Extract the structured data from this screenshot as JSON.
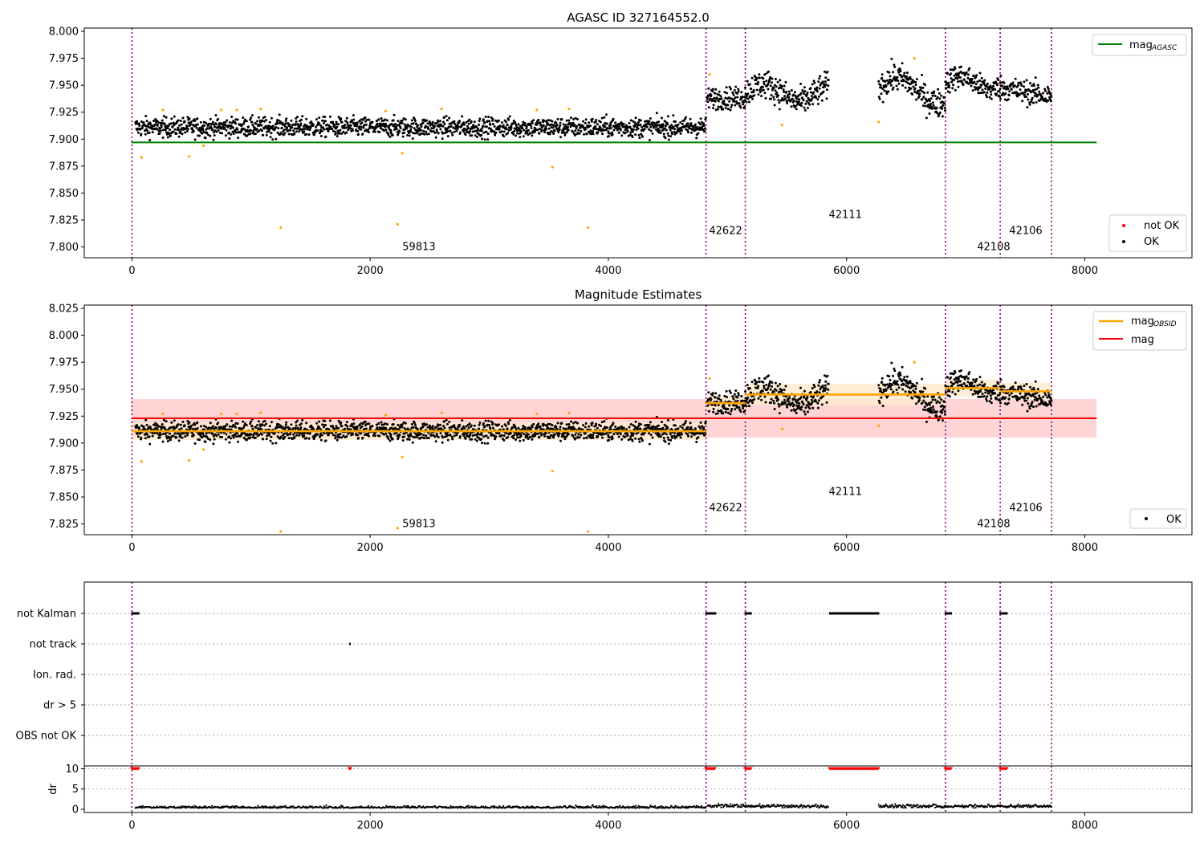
{
  "chart_data": [
    {
      "type": "scatter",
      "title": "AGASC ID 327164552.0",
      "xlim": [
        -400,
        8900
      ],
      "ylim": [
        7.79,
        8.003
      ],
      "x_ticks": [
        "0",
        "2000",
        "4000",
        "6000",
        "8000"
      ],
      "y_ticks": [
        "7.800",
        "7.825",
        "7.850",
        "7.875",
        "7.900",
        "7.925",
        "7.950",
        "7.975",
        "8.000"
      ],
      "legend_upper": {
        "position": "upper right",
        "entries": [
          {
            "label": "mag",
            "sub": "AGASC",
            "color": "#008000"
          }
        ]
      },
      "legend_lower": {
        "position": "lower right",
        "entries": [
          {
            "label": "not OK",
            "color": "#ff0000"
          },
          {
            "label": "OK",
            "color": "#000000"
          }
        ]
      },
      "mag_agasc": 7.897,
      "obsid_boundaries": [
        0,
        4820,
        5150,
        6830,
        7290,
        7720
      ],
      "obsid_labels": [
        {
          "text": "59813",
          "x": 2410,
          "y": 7.797
        },
        {
          "text": "42622",
          "x": 4985,
          "y": 7.812
        },
        {
          "text": "42111",
          "x": 5990,
          "y": 7.827
        },
        {
          "text": "42108",
          "x": 7235,
          "y": 7.797
        },
        {
          "text": "42106",
          "x": 7505,
          "y": 7.812
        }
      ]
    },
    {
      "type": "scatter",
      "title": "Magnitude Estimates",
      "xlim": [
        -400,
        8900
      ],
      "ylim": [
        7.815,
        8.028
      ],
      "x_ticks": [
        "0",
        "2000",
        "4000",
        "6000",
        "8000"
      ],
      "y_ticks": [
        "7.825",
        "7.850",
        "7.875",
        "7.900",
        "7.925",
        "7.950",
        "7.975",
        "8.000",
        "8.025"
      ],
      "legend_upper": {
        "position": "upper right",
        "entries": [
          {
            "label": "mag",
            "sub": "OBSID",
            "color": "#ffa500"
          },
          {
            "label": "mag",
            "color": "#ff0000"
          }
        ]
      },
      "legend_lower": {
        "position": "lower right",
        "entries": [
          {
            "label": "OK",
            "color": "#000000"
          }
        ]
      },
      "mag": 7.923,
      "mag_band": [
        7.905,
        7.941
      ],
      "mag_obsid": [
        {
          "start": 0,
          "end": 4820,
          "value": 7.911,
          "band": [
            7.903,
            7.919
          ]
        },
        {
          "start": 4820,
          "end": 5150,
          "value": 7.937,
          "band": [
            7.93,
            7.944
          ]
        },
        {
          "start": 5150,
          "end": 6830,
          "value": 7.945,
          "band": [
            7.935,
            7.955
          ]
        },
        {
          "start": 6830,
          "end": 7290,
          "value": 7.951,
          "band": [
            7.943,
            7.959
          ]
        },
        {
          "start": 7290,
          "end": 7720,
          "value": 7.948,
          "band": [
            7.94,
            7.956
          ]
        }
      ],
      "obsid_labels": [
        {
          "text": "59813",
          "x": 2410,
          "y": 7.822
        },
        {
          "text": "42622",
          "x": 4985,
          "y": 7.837
        },
        {
          "text": "42111",
          "x": 5990,
          "y": 7.852
        },
        {
          "text": "42108",
          "x": 7235,
          "y": 7.822
        },
        {
          "text": "42106",
          "x": 7505,
          "y": 7.837
        }
      ]
    },
    {
      "type": "scatter",
      "title": "",
      "xlim": [
        -400,
        8900
      ],
      "categories": [
        "not Kalman",
        "not track",
        "Ion. rad.",
        "dr > 5",
        "OBS not OK"
      ],
      "flag_ranges": {
        "not Kalman": [
          [
            0,
            60
          ],
          [
            4820,
            4900
          ],
          [
            5150,
            5200
          ],
          [
            5860,
            6270
          ],
          [
            6830,
            6880
          ],
          [
            7290,
            7350
          ]
        ],
        "not track": [
          [
            1830,
            1835
          ]
        ],
        "Ion. rad.": [],
        "dr > 5": [],
        "OBS not OK": []
      }
    },
    {
      "type": "scatter",
      "title": "",
      "xlim": [
        -400,
        8900
      ],
      "ylim": [
        -0.8,
        10.7
      ],
      "ylabel": "dr",
      "y_ticks": [
        "0",
        "5",
        "10"
      ],
      "x_ticks": [
        "0",
        "2000",
        "4000",
        "6000",
        "8000"
      ],
      "dr_clipped_ranges": [
        [
          0,
          60
        ],
        [
          1825,
          1835
        ],
        [
          4820,
          4900
        ],
        [
          5150,
          5200
        ],
        [
          5860,
          6270
        ],
        [
          6830,
          6880
        ],
        [
          7290,
          7350
        ]
      ],
      "dr_typical": 0.3
    }
  ],
  "colors": {
    "ok": "#000000",
    "not_ok": "#ff0000",
    "outlier": "#ffa500",
    "agasc_line": "#008000",
    "mag_line": "#ff0000",
    "mag_band": "#ffd4d4",
    "obsid_line": "#ffa500",
    "obsid_band": "#ffeacc",
    "boundary": "#800080"
  }
}
